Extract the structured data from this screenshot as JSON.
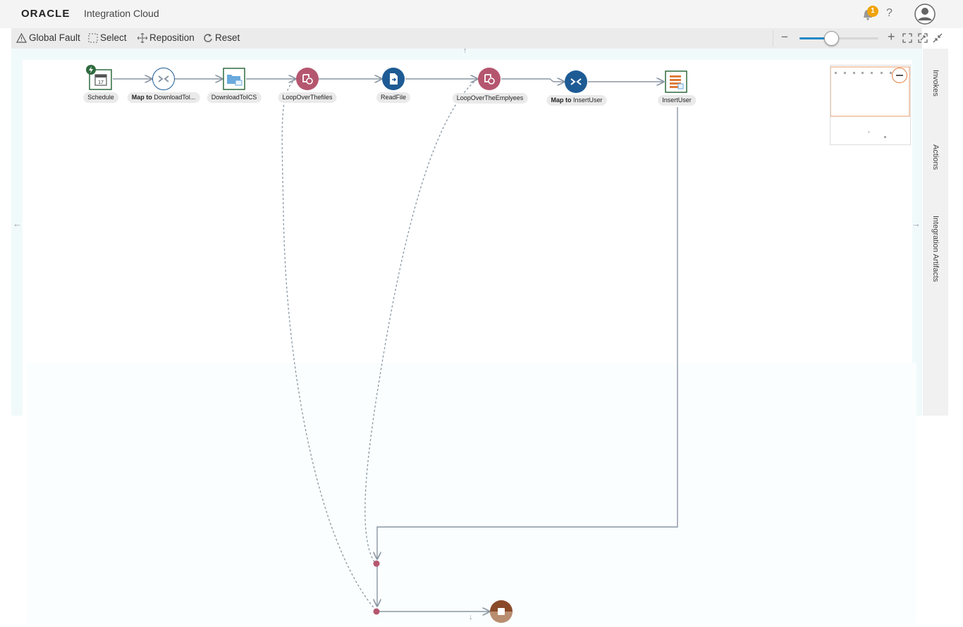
{
  "header": {
    "logo": "ORACLE",
    "app_name": "Integration Cloud",
    "notification_count": "1",
    "help_label": "?"
  },
  "toolbar": {
    "global_fault": "Global Fault",
    "select": "Select",
    "reposition": "Reposition",
    "reset": "Reset",
    "zoom_out": "−",
    "zoom_in": "+",
    "zoom_level": 0.4
  },
  "right_panel": {
    "tabs": [
      "Invokes",
      "Actions",
      "Integration Artifacts"
    ]
  },
  "flow": {
    "nodes": [
      {
        "id": "schedule",
        "label": "Schedule",
        "prefix": "",
        "icon": "calendar-icon"
      },
      {
        "id": "map1",
        "label": "DownloadTol...",
        "prefix": "Map to",
        "icon": "map-icon"
      },
      {
        "id": "download",
        "label": "DownloadToICS",
        "prefix": "",
        "icon": "stage-file-icon"
      },
      {
        "id": "loop1",
        "label": "LoopOverThefiles",
        "prefix": "",
        "icon": "for-each-icon"
      },
      {
        "id": "readfile",
        "label": "ReadFile",
        "prefix": "",
        "icon": "read-file-icon"
      },
      {
        "id": "loop2",
        "label": "LoopOverTheEmplyees",
        "prefix": "",
        "icon": "for-each-icon"
      },
      {
        "id": "map2",
        "label": "InsertUser",
        "prefix": "Map to",
        "icon": "map-icon"
      },
      {
        "id": "insertuser",
        "label": "InsertUser",
        "prefix": "",
        "icon": "database-adapter-icon"
      }
    ]
  },
  "colors": {
    "loop": "#b5566f",
    "action": "#1e5b94",
    "stage": "#2f6b3f",
    "end": "#8a4a28",
    "accent": "#e07b3c",
    "connector": "#8a96a3"
  }
}
